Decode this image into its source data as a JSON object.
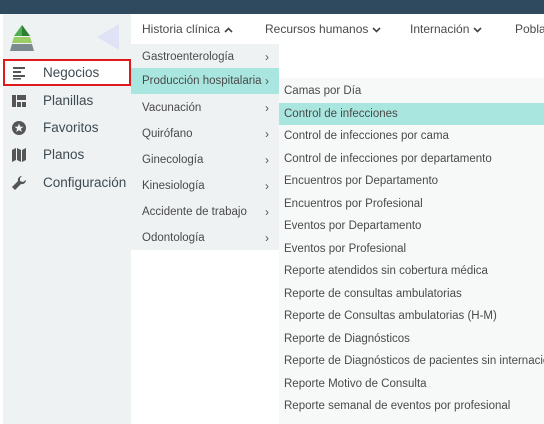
{
  "sidebar": {
    "logo_icon": "pyramid-logo-icon",
    "collapse_icon": "triangle-left-icon",
    "items": [
      {
        "label": "Negocios",
        "icon": "list-icon"
      },
      {
        "label": "Planillas",
        "icon": "grid-icon"
      },
      {
        "label": "Favoritos",
        "icon": "star-icon"
      },
      {
        "label": "Planos",
        "icon": "map-icon"
      },
      {
        "label": "Configuración",
        "icon": "wrench-icon"
      }
    ]
  },
  "topmenu": {
    "items": [
      {
        "label": "Historia clínica",
        "chevron": "^"
      },
      {
        "label": "Recursos humanos",
        "chevron": "v"
      },
      {
        "label": "Internación",
        "chevron": "v"
      },
      {
        "label": "Pobla"
      }
    ]
  },
  "dropdown": {
    "items": [
      {
        "label": "Gastroenterología"
      },
      {
        "label": "Producción hospitalaria"
      },
      {
        "label": "Vacunación"
      },
      {
        "label": "Quirófano"
      },
      {
        "label": "Ginecología"
      },
      {
        "label": "Kinesiología"
      },
      {
        "label": "Accidente de trabajo"
      },
      {
        "label": "Odontología"
      }
    ],
    "arrow": "›"
  },
  "submenu": {
    "items": [
      {
        "label": "Camas por Día"
      },
      {
        "label": "Control de infecciones"
      },
      {
        "label": "Control de infecciones por cama"
      },
      {
        "label": "Control de infecciones por departamento"
      },
      {
        "label": "Encuentros por Departamento"
      },
      {
        "label": "Encuentros por Profesional"
      },
      {
        "label": "Eventos por Departamento"
      },
      {
        "label": "Eventos por Profesional"
      },
      {
        "label": "Reporte atendidos sin cobertura médica"
      },
      {
        "label": "Reporte de consultas ambulatorias"
      },
      {
        "label": "Reporte de Consultas ambulatorias (H-M)"
      },
      {
        "label": "Reporte de Diagnósticos"
      },
      {
        "label": "Reporte de Diagnósticos de pacientes sin internación"
      },
      {
        "label": "Reporte Motivo de Consulta"
      },
      {
        "label": "Reporte semanal de eventos por profesional"
      }
    ]
  },
  "colors": {
    "topbar": "#2f4a5f",
    "sidebar_bg": "#eef2f3",
    "highlight": "#a9e6df",
    "active_outline": "#e0191d",
    "logo_green": "#4caf50"
  }
}
